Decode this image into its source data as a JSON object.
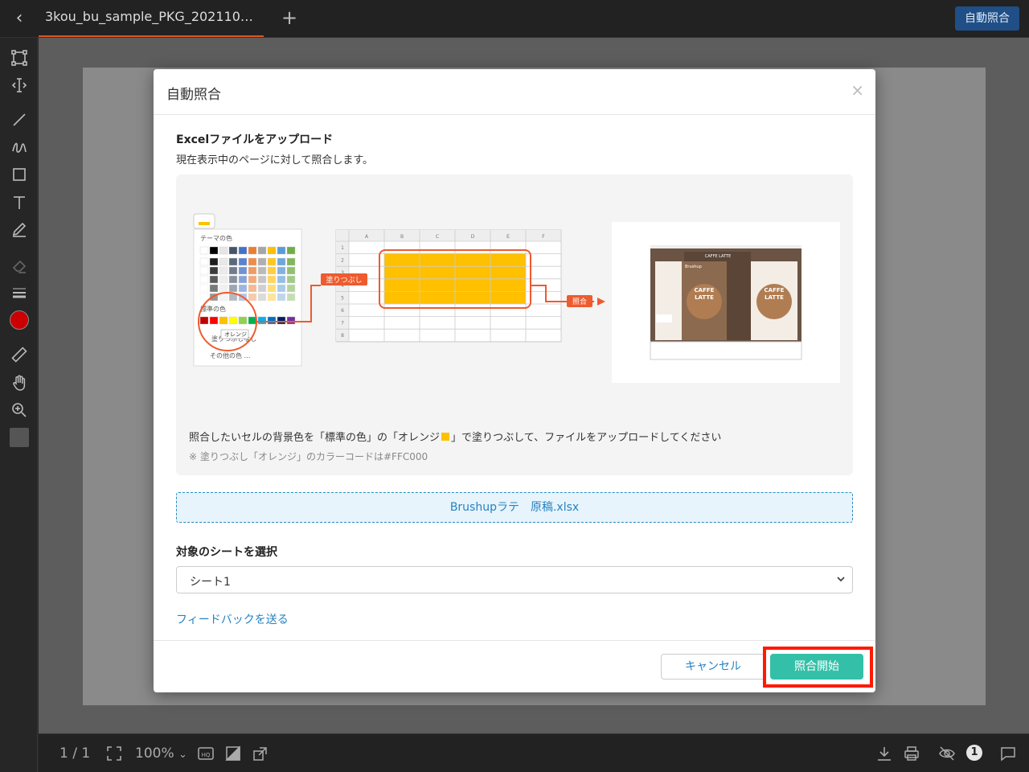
{
  "topbar": {
    "back_icon": "chevron-left-icon",
    "file_tab_label": "3kou_bu_sample_PKG_202110…",
    "add_tab_icon": "plus-icon",
    "auto_match_button": "自動照合"
  },
  "toolbar": {
    "tools": [
      "select-frame-icon",
      "text-cursor-icon",
      "line-icon",
      "freehand-icon",
      "rectangle-icon",
      "text-icon",
      "marker-icon",
      "eraser-icon",
      "stroke-width-icon",
      "color-picker",
      "ruler-icon",
      "hand-icon",
      "zoom-icon",
      "fill-swatch"
    ],
    "active_color": "#cc0000"
  },
  "bottombar": {
    "page_indicator": "1 / 1",
    "zoom_level": "100%",
    "zoom_chevron": "⌄",
    "notification_count": "1"
  },
  "modal": {
    "title": "自動照合",
    "close_icon": "×",
    "upload_heading": "Excelファイルをアップロード",
    "upload_sub": "現在表示中のページに対して照合します。",
    "illustration": {
      "theme_colors_label": "テーマの色",
      "standard_colors_label": "標準の色",
      "tooltip": "オレンジ",
      "fill_menu_item": "塗りつぶしなし",
      "more_colors": "その他の色 …",
      "fill_badge": "塗りつぶし",
      "match_badge": "照合",
      "column_headers": [
        "A",
        "B",
        "C",
        "D",
        "E",
        "F"
      ],
      "row_headers": [
        "1",
        "2",
        "3",
        "4",
        "5",
        "6",
        "7",
        "8"
      ],
      "package_brand": "Brushup",
      "package_name_1": "CAFFE",
      "package_name_2": "LATTE",
      "package_header": "CAFFE LATTE"
    },
    "instruction_pre": "照合したいセルの背景色を「標準の色」の「オレンジ",
    "instruction_post": "」で塗りつぶして、ファイルをアップロードしてください",
    "note": "※ 塗りつぶし「オレンジ」のカラーコードは#FFC000",
    "orange_color": "#FFC000",
    "uploaded_file": "Brushupラテ　原稿.xlsx",
    "sheet_label": "対象のシートを選択",
    "sheet_selected": "シート1",
    "feedback_link": "フィードバックを送る",
    "cancel_button": "キャンセル",
    "start_button": "照合開始"
  }
}
